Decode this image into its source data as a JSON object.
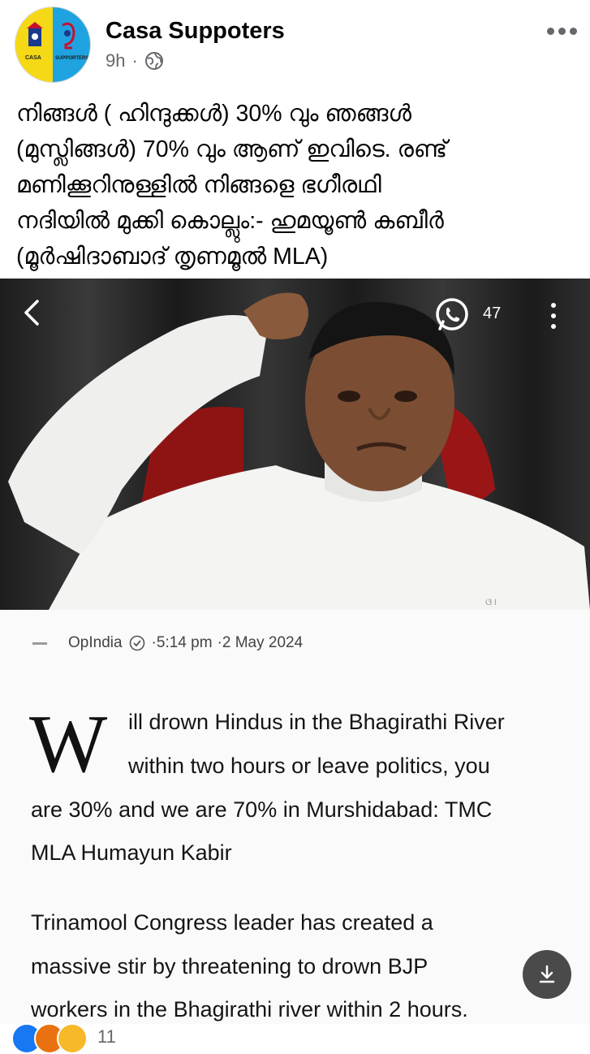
{
  "post": {
    "page_name": "Casa Suppoters",
    "time": "9h",
    "separator": "·",
    "caption_lines": [
      "നിങ്ങൾ ( ഹിന്ദുക്കൾ) 30% വും ഞങ്ങൾ",
      "(മുസ്ലിങ്ങൾ) 70% വും ആണ് ഇവിടെ. രണ്ട്",
      "മണിക്കൂറിനുള്ളിൽ നിങ്ങളെ ഭഗീരഥി",
      "നദിയിൽ മുക്കി കൊല്ലും:- ഹുമയൂൺ കബീർ",
      "(മൂർഷിദാബാദ് തൃണമൂൽ MLA)"
    ]
  },
  "avatar": {
    "left_text": "CASA",
    "right_text": "SUPPORTERS"
  },
  "photo": {
    "share_count": "47"
  },
  "article": {
    "source": "OpIndia",
    "time": "·5:14 pm",
    "date": "·2 May 2024",
    "dropcap": "W",
    "headline_lines": [
      "ill drown Hindus in the Bhagirathi River",
      "within two hours or leave politics, you",
      "are 30% and we are 70% in Murshidabad: TMC",
      "MLA Humayun Kabir"
    ],
    "body_lines": [
      "Trinamool Congress leader has created a",
      "massive stir by threatening to drown BJP",
      "workers in the Bhagirathi river within 2 hours."
    ]
  },
  "reactions": {
    "count": "11"
  },
  "colors": {
    "facebook_blue": "#1877f2",
    "meta_gray": "#65676b",
    "avatar_yellow": "#f5d816",
    "avatar_blue": "#1fa3e0"
  }
}
